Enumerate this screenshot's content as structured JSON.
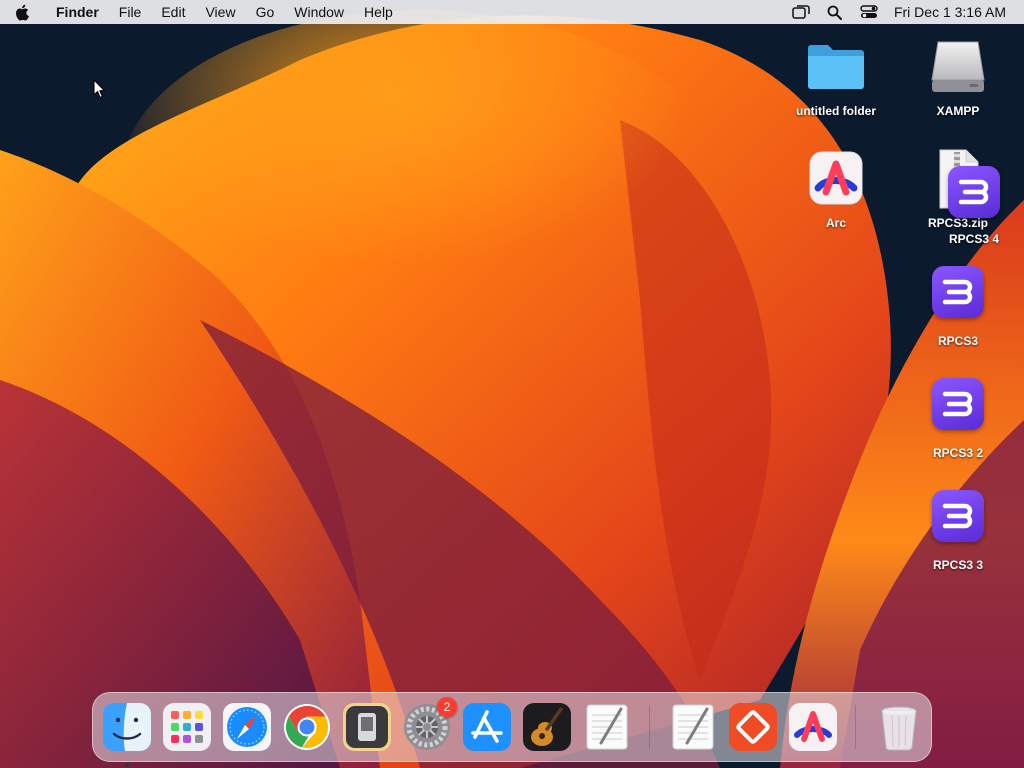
{
  "menubar": {
    "app_name": "Finder",
    "items": [
      "File",
      "Edit",
      "View",
      "Go",
      "Window",
      "Help"
    ],
    "clock": "Fri Dec 1  3:16 AM"
  },
  "desktop": {
    "icons": [
      {
        "label": "untitled folder",
        "icon": "folder-icon"
      },
      {
        "label": "XAMPP",
        "icon": "disk-icon"
      },
      {
        "label": "Arc",
        "icon": "arc-icon"
      },
      {
        "label": "RPCS3.zip",
        "icon": "zip-icon"
      },
      {
        "label": "RPCS3 4",
        "icon": "rpcs3-icon"
      },
      {
        "label": "RPCS3",
        "icon": "rpcs3-icon"
      },
      {
        "label": "RPCS3 2",
        "icon": "rpcs3-icon"
      },
      {
        "label": "RPCS3 3",
        "icon": "rpcs3-icon"
      }
    ]
  },
  "dock": {
    "apps": [
      "finder-icon",
      "launchpad-icon",
      "safari-icon",
      "chrome-icon",
      "simulator-icon",
      "system-settings-icon",
      "app-store-icon",
      "garageband-icon",
      "textedit-icon",
      "textedit-icon",
      "anydesk-icon",
      "arc-icon",
      "trash-icon"
    ],
    "settings_badge": "2"
  },
  "colors": {
    "rpcs3": "#6a3ae6",
    "badge": "#ff3b30",
    "menubar": "#ececee"
  }
}
